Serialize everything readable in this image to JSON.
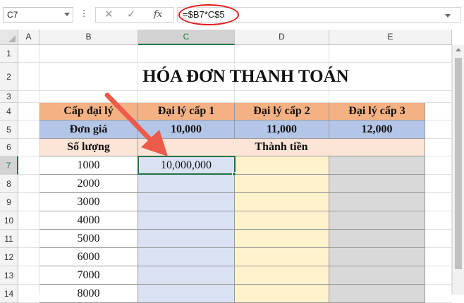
{
  "formula_bar": {
    "name_box": "C7",
    "cancel_icon": "✕",
    "enter_icon": "✓",
    "fx_label": "fx",
    "formula": "=$B7*C$5"
  },
  "columns": [
    "A",
    "B",
    "C",
    "D",
    "E"
  ],
  "selected_column": "C",
  "selected_row": "7",
  "rows": [
    "1",
    "2",
    "3",
    "4",
    "5",
    "6",
    "7",
    "8",
    "9",
    "10",
    "11",
    "12",
    "13",
    "14"
  ],
  "sheet": {
    "title": "HÓA ĐƠN THANH TOÁN",
    "header_row": [
      "Cấp đại lý",
      "Đại lý cấp 1",
      "Đại lý cấp 2",
      "Đại lý cấp 3"
    ],
    "price_row": [
      "Đơn giá",
      "10,000",
      "11,000",
      "12,000"
    ],
    "quantity_label": "Số lượng",
    "total_label": "Thành tiền",
    "quantities": [
      "1000",
      "2000",
      "3000",
      "4000",
      "5000",
      "6000",
      "7000",
      "8000"
    ],
    "c7_value": "10,000,000"
  },
  "colors": {
    "header_fill": "#f4b183",
    "price_fill": "#b4c6e7",
    "label_fill": "#fce4d6",
    "col_c_fill": "#d9e1f2",
    "col_d_fill": "#fff2cc",
    "col_e_fill": "#d9d9d9",
    "accent_green": "#217346",
    "annotation_red": "#e31b1b",
    "arrow_red": "#ec5a4a"
  }
}
